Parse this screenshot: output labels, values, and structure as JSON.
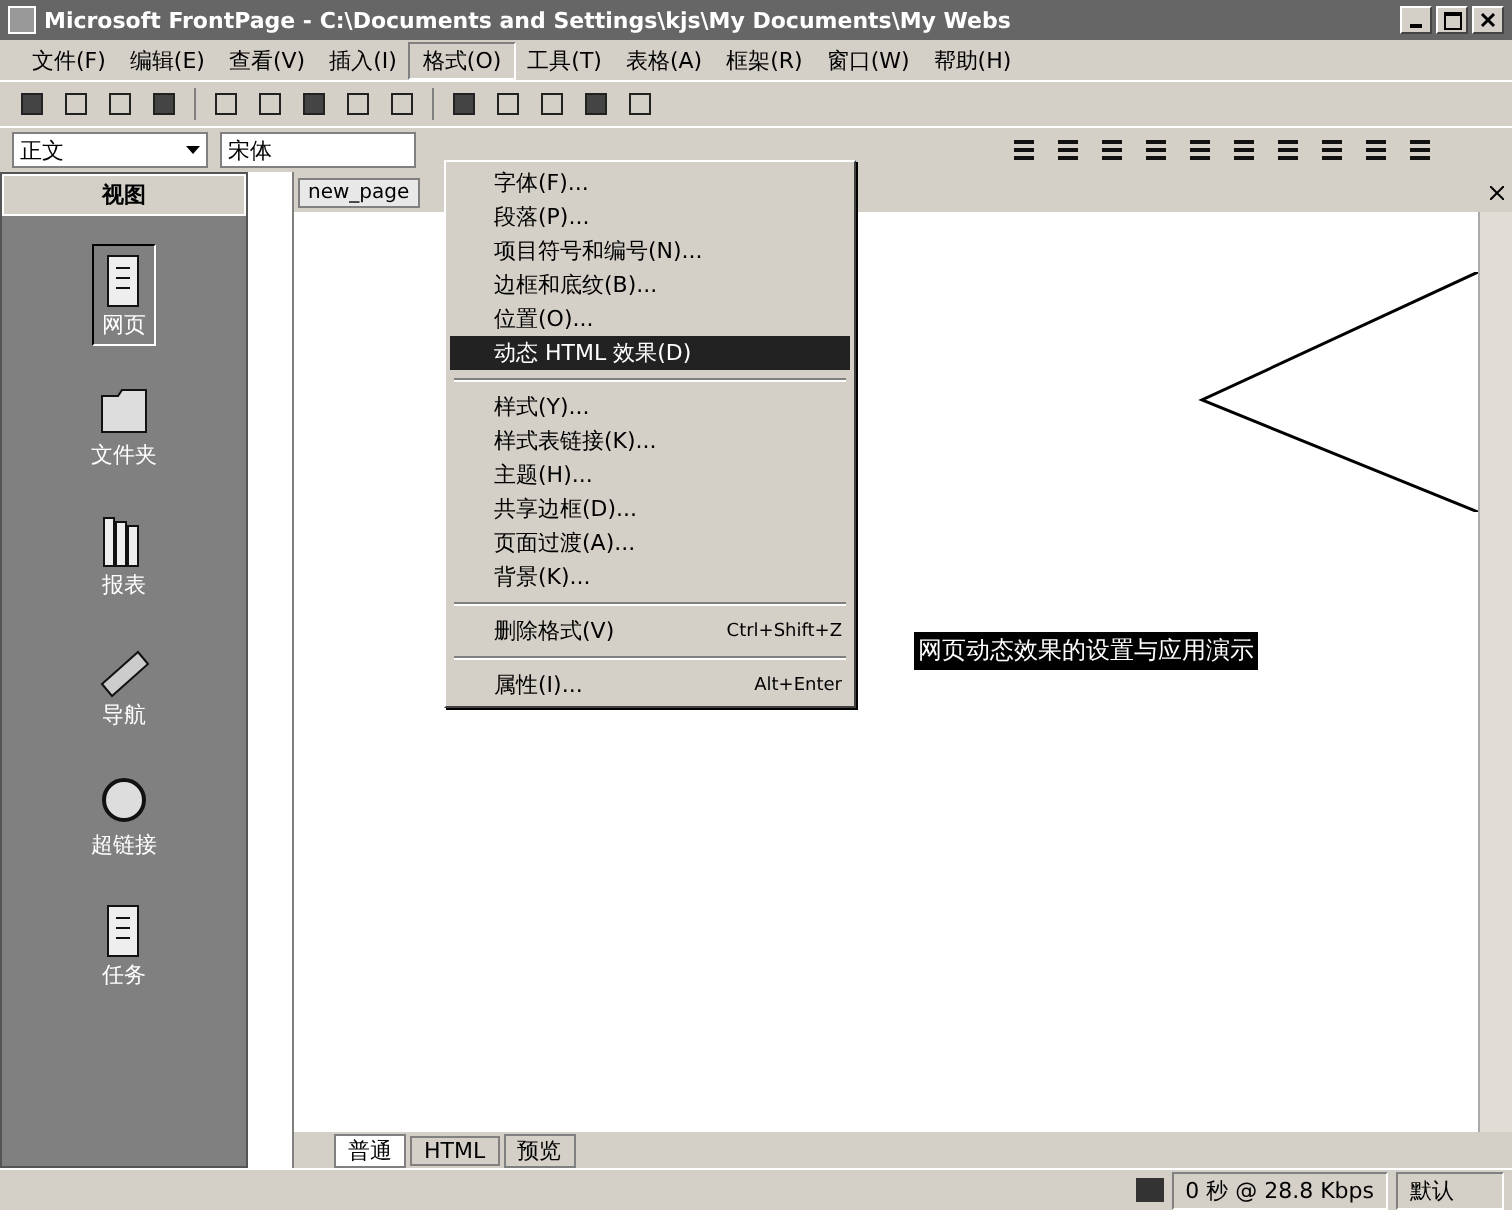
{
  "window": {
    "title": "Microsoft FrontPage - C:\\Documents and Settings\\kjs\\My Documents\\My Webs"
  },
  "menu_bar": [
    {
      "label": "文件(F)",
      "selected": false
    },
    {
      "label": "编辑(E)",
      "selected": false
    },
    {
      "label": "查看(V)",
      "selected": false
    },
    {
      "label": "插入(I)",
      "selected": false
    },
    {
      "label": "格式(O)",
      "selected": true
    },
    {
      "label": "工具(T)",
      "selected": false
    },
    {
      "label": "表格(A)",
      "selected": false
    },
    {
      "label": "框架(R)",
      "selected": false
    },
    {
      "label": "窗口(W)",
      "selected": false
    },
    {
      "label": "帮助(H)",
      "selected": false
    }
  ],
  "format_menu": [
    {
      "kind": "item",
      "label": "字体(F)...",
      "selected": false
    },
    {
      "kind": "item",
      "label": "段落(P)...",
      "selected": false
    },
    {
      "kind": "item",
      "label": "项目符号和编号(N)...",
      "selected": false
    },
    {
      "kind": "item",
      "label": "边框和底纹(B)...",
      "selected": false
    },
    {
      "kind": "item",
      "label": "位置(O)...",
      "selected": false
    },
    {
      "kind": "item",
      "label": "动态 HTML 效果(D)",
      "selected": true
    },
    {
      "kind": "separator"
    },
    {
      "kind": "item",
      "label": "样式(Y)...",
      "selected": false
    },
    {
      "kind": "item",
      "label": "样式表链接(K)...",
      "selected": false
    },
    {
      "kind": "item",
      "label": "主题(H)...",
      "selected": false
    },
    {
      "kind": "item",
      "label": "共享边框(D)...",
      "selected": false
    },
    {
      "kind": "item",
      "label": "页面过渡(A)...",
      "selected": false
    },
    {
      "kind": "item",
      "label": "背景(K)...",
      "selected": false
    },
    {
      "kind": "separator"
    },
    {
      "kind": "item",
      "label": "删除格式(V)",
      "shortcut": "Ctrl+Shift+Z",
      "selected": false
    },
    {
      "kind": "separator"
    },
    {
      "kind": "item",
      "label": "属性(I)...",
      "shortcut": "Alt+Enter",
      "selected": false
    }
  ],
  "format_toolbar": {
    "style": "正文",
    "font": "宋体"
  },
  "views": {
    "title": "视图",
    "items": [
      {
        "label": "网页",
        "selected": true
      },
      {
        "label": "文件夹",
        "selected": false
      },
      {
        "label": "报表",
        "selected": false
      },
      {
        "label": "导航",
        "selected": false
      },
      {
        "label": "超链接",
        "selected": false
      },
      {
        "label": "任务",
        "selected": false
      }
    ]
  },
  "editor": {
    "tab": "new_page",
    "page_text": "网页动态效果的设置与应用演示"
  },
  "view_tabs": [
    {
      "label": "普通",
      "selected": true
    },
    {
      "label": "HTML",
      "selected": false
    },
    {
      "label": "预览",
      "selected": false
    }
  ],
  "status_bar": {
    "download": "0 秒 @ 28.8 Kbps",
    "mode": "默认"
  }
}
